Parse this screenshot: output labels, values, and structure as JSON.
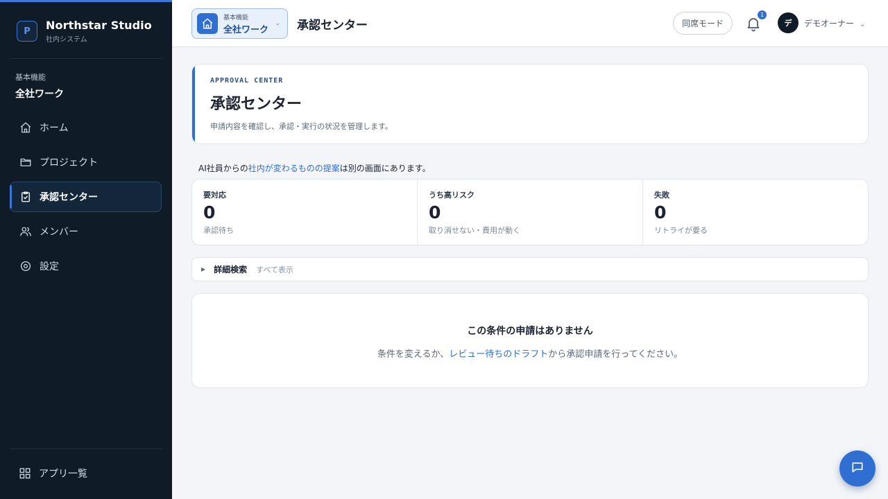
{
  "brand": {
    "logo_letter": "P",
    "name": "Northstar Studio",
    "subtitle": "社内システム"
  },
  "sidebar": {
    "section_label": "基本機能",
    "workspace": "全社ワーク",
    "items": [
      {
        "label": "ホーム",
        "icon": "home-icon"
      },
      {
        "label": "プロジェクト",
        "icon": "folder-icon"
      },
      {
        "label": "承認センター",
        "icon": "clipboard-check-icon",
        "active": true
      },
      {
        "label": "メンバー",
        "icon": "users-icon"
      },
      {
        "label": "設定",
        "icon": "gear-icon"
      }
    ],
    "apps_label": "アプリ一覧"
  },
  "header": {
    "workspace_label": "基本機能",
    "workspace_name": "全社ワーク",
    "title": "承認センター",
    "presence_button": "同席モード",
    "notification_count": "1",
    "user_initial": "デ",
    "user_name": "デモオーナー"
  },
  "hero": {
    "eyebrow": "APPROVAL CENTER",
    "title": "承認センター",
    "description": "申請内容を確認し、承認・実行の状況を管理します。"
  },
  "notice": {
    "prefix": "AI社員からの",
    "link": "社内が変わるものの提案",
    "suffix": "は別の画面にあります。"
  },
  "stats": [
    {
      "label": "要対応",
      "value": "0",
      "sub": "承認待ち"
    },
    {
      "label": "うち高リスク",
      "value": "0",
      "sub": "取り消せない・費用が動く"
    },
    {
      "label": "失敗",
      "value": "0",
      "sub": "リトライが要る"
    }
  ],
  "filter": {
    "title": "詳細検索",
    "summary": "すべて表示"
  },
  "empty": {
    "title": "この条件の申請はありません",
    "desc_prefix": "条件を変えるか、",
    "desc_link": "レビュー待ちのドラフト",
    "desc_suffix": "から承認申請を行ってください。"
  },
  "colors": {
    "sidebar_bg": "#0f1b27",
    "accent": "#2f6fd1",
    "page_bg": "#f3f5f8"
  }
}
